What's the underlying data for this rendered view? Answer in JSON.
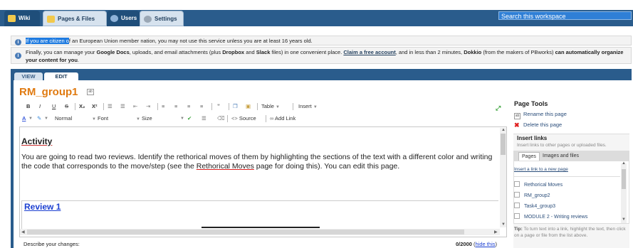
{
  "nav": {
    "tabs": [
      {
        "label": "Wiki"
      },
      {
        "label": "Pages & Files"
      },
      {
        "label": "Users"
      },
      {
        "label": "Settings"
      }
    ],
    "search_placeholder": "Search this workspace"
  },
  "notices": {
    "first_highlight": "If you are citizen o",
    "first_rest": "f an European Union member nation, you may not use this service unless you are at least 16 years old.",
    "second": {
      "p1": "Finally, you can manage your ",
      "b1": "Google Docs",
      "p2": ", uploads, and email attachments (plus ",
      "b2": "Dropbox",
      "p3": " and ",
      "b3": "Slack",
      "p4": " files) in one convenient place. ",
      "link": "Claim a free account",
      "p5": ", and in less than 2 minutes, ",
      "b4": "Dokkio",
      "p6": " (from the makers of PBworks) ",
      "b5": "can automatically organize your content for you",
      "p7": "."
    }
  },
  "edit_tabs": {
    "view": "VIEW",
    "edit": "EDIT"
  },
  "page_title": "RM_group1",
  "toolbar": {
    "bold": "B",
    "italic": "I",
    "underline": "U",
    "strike": "S",
    "subscript": "X₂",
    "superscript": "X²",
    "table": "Table",
    "insert": "Insert",
    "format": "Normal",
    "font": "Font",
    "size": "Size",
    "source": "Source",
    "add_link": "Add Link"
  },
  "content": {
    "heading": "Activity",
    "paragraph_start": "You are going to read two reviews. Identify the rethorical moves of them by highlighting the sections of the text with a different color and writing the code that corresponds to the move/step (see the ",
    "paragraph_link": "Rethorical Moves",
    "paragraph_end": " page for doing this). You can edit this page.",
    "review_heading": "Review 1"
  },
  "footer": {
    "describe": "Describe your changes:",
    "count": "0/2000",
    "hide": "hide this"
  },
  "page_tools": {
    "title": "Page Tools",
    "rename": "Rename this page",
    "delete": "Delete this page"
  },
  "insert_links": {
    "title": "Insert links",
    "description": "Insert links to other pages or uploaded files.",
    "tab_pages": "Pages",
    "tab_images": "Images and files",
    "new_page_link": "Insert a link to a new page",
    "items": [
      "Rethorical Moves",
      "RM_group2",
      "Task4_group3",
      "MODULE 2 - Writing reviews"
    ],
    "tip_label": "Tip:",
    "tip_text": "To turn text into a link, highlight the text, then click on a page or file from the list above."
  },
  "colors": {
    "nav_blue": "#2a5c8c",
    "title_orange": "#e07a10",
    "link_blue": "#1b3fd1",
    "delete_red": "#e02020"
  }
}
